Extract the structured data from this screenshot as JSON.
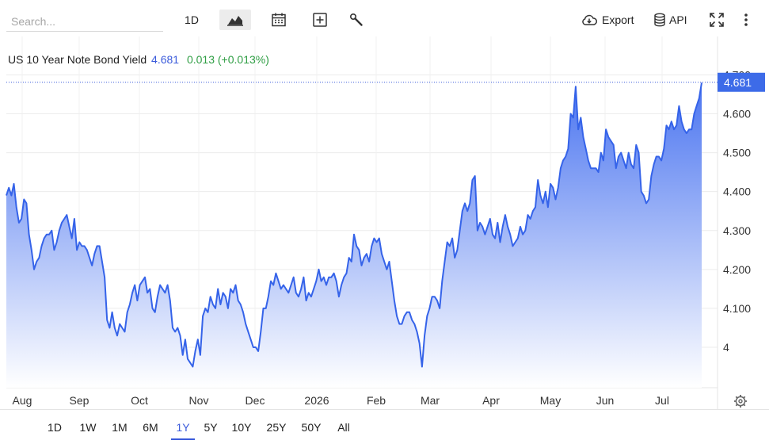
{
  "toolbar": {
    "search_placeholder": "Search...",
    "interval_label": "1D",
    "export_label": "Export",
    "api_label": "API"
  },
  "header": {
    "name": "US 10 Year Note Bond Yield",
    "value": "4.681",
    "change": "0.013 (+0.013%)"
  },
  "ranges": [
    "1D",
    "1W",
    "1M",
    "6M",
    "1Y",
    "5Y",
    "10Y",
    "25Y",
    "50Y",
    "All"
  ],
  "selected_range": "1Y",
  "colors": {
    "line": "#3563e9",
    "fill_top": "#4a74f0",
    "fill_bottom": "#ffffff",
    "price_tag": "#3d6be8",
    "change_up": "#2f9e44"
  },
  "chart_data": {
    "type": "area",
    "title": "US 10 Year Note Bond Yield",
    "xlabel": "",
    "ylabel": "",
    "x_tick_labels": [
      "Aug",
      "Sep",
      "Oct",
      "Nov",
      "Dec",
      "2026",
      "Feb",
      "Mar",
      "Apr",
      "May",
      "Jun",
      "Jul"
    ],
    "y_tick_labels": [
      "4",
      "4.100",
      "4.200",
      "4.300",
      "4.400",
      "4.500",
      "4.600",
      "4.700"
    ],
    "ylim": [
      3.9,
      4.79
    ],
    "last_value": 4.681,
    "last_label": "4.681",
    "grid": true,
    "series": [
      {
        "values": [
          4.39,
          4.41,
          4.39,
          4.42,
          4.36,
          4.32,
          4.33,
          4.38,
          4.37,
          4.29,
          4.25,
          4.2,
          4.22,
          4.23,
          4.26,
          4.28,
          4.29,
          4.29,
          4.3,
          4.25,
          4.27,
          4.3,
          4.32,
          4.33,
          4.34,
          4.31,
          4.28,
          4.33,
          4.25,
          4.27,
          4.26,
          4.26,
          4.25,
          4.23,
          4.21,
          4.24,
          4.26,
          4.26,
          4.22,
          4.18,
          4.07,
          4.05,
          4.09,
          4.05,
          4.03,
          4.06,
          4.05,
          4.04,
          4.09,
          4.11,
          4.14,
          4.16,
          4.12,
          4.16,
          4.17,
          4.18,
          4.14,
          4.15,
          4.1,
          4.09,
          4.13,
          4.16,
          4.15,
          4.14,
          4.16,
          4.12,
          4.05,
          4.04,
          4.05,
          4.03,
          3.98,
          4.02,
          3.97,
          3.96,
          3.95,
          3.99,
          4.02,
          3.98,
          4.08,
          4.1,
          4.09,
          4.13,
          4.11,
          4.1,
          4.15,
          4.11,
          4.14,
          4.13,
          4.1,
          4.15,
          4.14,
          4.16,
          4.12,
          4.11,
          4.09,
          4.06,
          4.04,
          4.02,
          4.0,
          4.0,
          3.99,
          4.04,
          4.1,
          4.1,
          4.13,
          4.17,
          4.16,
          4.19,
          4.17,
          4.15,
          4.16,
          4.15,
          4.14,
          4.16,
          4.18,
          4.14,
          4.13,
          4.15,
          4.18,
          4.12,
          4.14,
          4.13,
          4.15,
          4.17,
          4.2,
          4.17,
          4.18,
          4.16,
          4.18,
          4.18,
          4.19,
          4.17,
          4.13,
          4.16,
          4.18,
          4.19,
          4.23,
          4.22,
          4.29,
          4.26,
          4.25,
          4.21,
          4.23,
          4.24,
          4.22,
          4.26,
          4.28,
          4.27,
          4.28,
          4.24,
          4.22,
          4.2,
          4.22,
          4.17,
          4.12,
          4.08,
          4.06,
          4.06,
          4.08,
          4.09,
          4.09,
          4.07,
          4.06,
          4.04,
          4.01,
          3.95,
          4.03,
          4.08,
          4.1,
          4.13,
          4.13,
          4.12,
          4.1,
          4.17,
          4.22,
          4.27,
          4.26,
          4.28,
          4.23,
          4.25,
          4.3,
          4.35,
          4.37,
          4.35,
          4.37,
          4.43,
          4.44,
          4.3,
          4.32,
          4.31,
          4.29,
          4.31,
          4.33,
          4.29,
          4.28,
          4.32,
          4.27,
          4.31,
          4.34,
          4.31,
          4.29,
          4.26,
          4.27,
          4.28,
          4.31,
          4.29,
          4.3,
          4.34,
          4.33,
          4.35,
          4.36,
          4.43,
          4.39,
          4.37,
          4.4,
          4.36,
          4.42,
          4.41,
          4.38,
          4.41,
          4.46,
          4.48,
          4.49,
          4.51,
          4.6,
          4.59,
          4.67,
          4.56,
          4.59,
          4.54,
          4.51,
          4.48,
          4.46,
          4.46,
          4.46,
          4.45,
          4.5,
          4.48,
          4.56,
          4.54,
          4.53,
          4.52,
          4.46,
          4.49,
          4.5,
          4.48,
          4.46,
          4.5,
          4.47,
          4.46,
          4.52,
          4.5,
          4.4,
          4.39,
          4.37,
          4.38,
          4.44,
          4.47,
          4.49,
          4.49,
          4.48,
          4.51,
          4.57,
          4.56,
          4.58,
          4.56,
          4.57,
          4.62,
          4.58,
          4.56,
          4.55,
          4.56,
          4.56,
          4.6,
          4.62,
          4.64,
          4.68
        ]
      }
    ]
  }
}
